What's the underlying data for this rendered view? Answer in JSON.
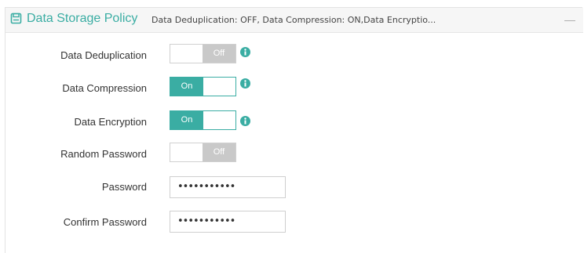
{
  "panel": {
    "title": "Data Storage Policy",
    "summary": "Data Deduplication: OFF, Data Compression: ON,Data Encryptio...",
    "collapse_label": "—"
  },
  "fields": {
    "dedup": {
      "label": "Data Deduplication",
      "state": "Off"
    },
    "compress": {
      "label": "Data Compression",
      "state": "On"
    },
    "encrypt": {
      "label": "Data Encryption",
      "state": "On"
    },
    "random": {
      "label": "Random Password",
      "state": "Off"
    },
    "password": {
      "label": "Password",
      "value": "•••••••••••"
    },
    "confirm": {
      "label": "Confirm Password",
      "value": "•••••••••••"
    }
  },
  "icons": {
    "header": "storage-icon",
    "info": "info-icon",
    "collapse": "minus-icon"
  },
  "colors": {
    "accent": "#3aada3",
    "toggle_off": "#c9c9c9"
  }
}
